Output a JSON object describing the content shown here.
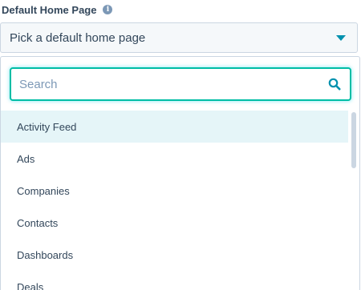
{
  "field": {
    "label": "Default Home Page",
    "info_icon": "info-icon"
  },
  "select": {
    "value": "Pick a default home page",
    "caret_icon": "caret-down-icon"
  },
  "search": {
    "placeholder": "Search",
    "value": "",
    "icon": "search-icon"
  },
  "options": [
    {
      "label": "Activity Feed",
      "highlighted": true
    },
    {
      "label": "Ads",
      "highlighted": false
    },
    {
      "label": "Companies",
      "highlighted": false
    },
    {
      "label": "Contacts",
      "highlighted": false
    },
    {
      "label": "Dashboards",
      "highlighted": false
    },
    {
      "label": "Deals",
      "highlighted": false
    }
  ],
  "colors": {
    "accent": "#0091ae",
    "focus_border": "#00bda5",
    "highlight_row": "#e5f5f8",
    "text": "#33475b",
    "placeholder": "#7c98b6"
  }
}
